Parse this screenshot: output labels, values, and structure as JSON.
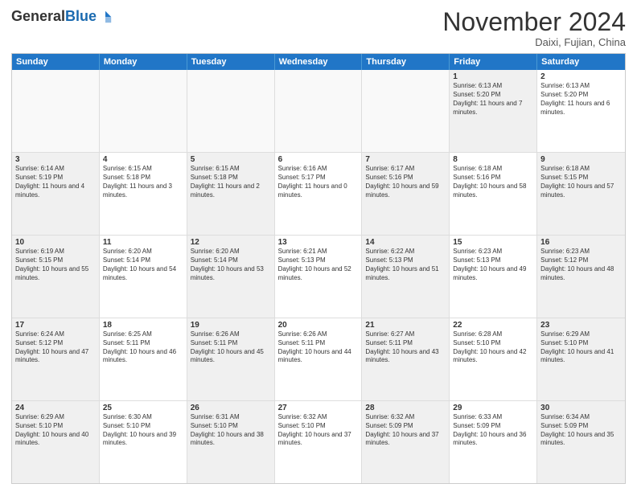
{
  "header": {
    "logo_general": "General",
    "logo_blue": "Blue",
    "month_title": "November 2024",
    "location": "Daixi, Fujian, China"
  },
  "weekdays": [
    "Sunday",
    "Monday",
    "Tuesday",
    "Wednesday",
    "Thursday",
    "Friday",
    "Saturday"
  ],
  "rows": [
    [
      {
        "day": "",
        "text": "",
        "empty": true
      },
      {
        "day": "",
        "text": "",
        "empty": true
      },
      {
        "day": "",
        "text": "",
        "empty": true
      },
      {
        "day": "",
        "text": "",
        "empty": true
      },
      {
        "day": "",
        "text": "",
        "empty": true
      },
      {
        "day": "1",
        "text": "Sunrise: 6:13 AM\nSunset: 5:20 PM\nDaylight: 11 hours and 7 minutes.",
        "shaded": true
      },
      {
        "day": "2",
        "text": "Sunrise: 6:13 AM\nSunset: 5:20 PM\nDaylight: 11 hours and 6 minutes.",
        "shaded": false
      }
    ],
    [
      {
        "day": "3",
        "text": "Sunrise: 6:14 AM\nSunset: 5:19 PM\nDaylight: 11 hours and 4 minutes.",
        "shaded": true
      },
      {
        "day": "4",
        "text": "Sunrise: 6:15 AM\nSunset: 5:18 PM\nDaylight: 11 hours and 3 minutes.",
        "shaded": false
      },
      {
        "day": "5",
        "text": "Sunrise: 6:15 AM\nSunset: 5:18 PM\nDaylight: 11 hours and 2 minutes.",
        "shaded": true
      },
      {
        "day": "6",
        "text": "Sunrise: 6:16 AM\nSunset: 5:17 PM\nDaylight: 11 hours and 0 minutes.",
        "shaded": false
      },
      {
        "day": "7",
        "text": "Sunrise: 6:17 AM\nSunset: 5:16 PM\nDaylight: 10 hours and 59 minutes.",
        "shaded": true
      },
      {
        "day": "8",
        "text": "Sunrise: 6:18 AM\nSunset: 5:16 PM\nDaylight: 10 hours and 58 minutes.",
        "shaded": false
      },
      {
        "day": "9",
        "text": "Sunrise: 6:18 AM\nSunset: 5:15 PM\nDaylight: 10 hours and 57 minutes.",
        "shaded": true
      }
    ],
    [
      {
        "day": "10",
        "text": "Sunrise: 6:19 AM\nSunset: 5:15 PM\nDaylight: 10 hours and 55 minutes.",
        "shaded": true
      },
      {
        "day": "11",
        "text": "Sunrise: 6:20 AM\nSunset: 5:14 PM\nDaylight: 10 hours and 54 minutes.",
        "shaded": false
      },
      {
        "day": "12",
        "text": "Sunrise: 6:20 AM\nSunset: 5:14 PM\nDaylight: 10 hours and 53 minutes.",
        "shaded": true
      },
      {
        "day": "13",
        "text": "Sunrise: 6:21 AM\nSunset: 5:13 PM\nDaylight: 10 hours and 52 minutes.",
        "shaded": false
      },
      {
        "day": "14",
        "text": "Sunrise: 6:22 AM\nSunset: 5:13 PM\nDaylight: 10 hours and 51 minutes.",
        "shaded": true
      },
      {
        "day": "15",
        "text": "Sunrise: 6:23 AM\nSunset: 5:13 PM\nDaylight: 10 hours and 49 minutes.",
        "shaded": false
      },
      {
        "day": "16",
        "text": "Sunrise: 6:23 AM\nSunset: 5:12 PM\nDaylight: 10 hours and 48 minutes.",
        "shaded": true
      }
    ],
    [
      {
        "day": "17",
        "text": "Sunrise: 6:24 AM\nSunset: 5:12 PM\nDaylight: 10 hours and 47 minutes.",
        "shaded": true
      },
      {
        "day": "18",
        "text": "Sunrise: 6:25 AM\nSunset: 5:11 PM\nDaylight: 10 hours and 46 minutes.",
        "shaded": false
      },
      {
        "day": "19",
        "text": "Sunrise: 6:26 AM\nSunset: 5:11 PM\nDaylight: 10 hours and 45 minutes.",
        "shaded": true
      },
      {
        "day": "20",
        "text": "Sunrise: 6:26 AM\nSunset: 5:11 PM\nDaylight: 10 hours and 44 minutes.",
        "shaded": false
      },
      {
        "day": "21",
        "text": "Sunrise: 6:27 AM\nSunset: 5:11 PM\nDaylight: 10 hours and 43 minutes.",
        "shaded": true
      },
      {
        "day": "22",
        "text": "Sunrise: 6:28 AM\nSunset: 5:10 PM\nDaylight: 10 hours and 42 minutes.",
        "shaded": false
      },
      {
        "day": "23",
        "text": "Sunrise: 6:29 AM\nSunset: 5:10 PM\nDaylight: 10 hours and 41 minutes.",
        "shaded": true
      }
    ],
    [
      {
        "day": "24",
        "text": "Sunrise: 6:29 AM\nSunset: 5:10 PM\nDaylight: 10 hours and 40 minutes.",
        "shaded": true
      },
      {
        "day": "25",
        "text": "Sunrise: 6:30 AM\nSunset: 5:10 PM\nDaylight: 10 hours and 39 minutes.",
        "shaded": false
      },
      {
        "day": "26",
        "text": "Sunrise: 6:31 AM\nSunset: 5:10 PM\nDaylight: 10 hours and 38 minutes.",
        "shaded": true
      },
      {
        "day": "27",
        "text": "Sunrise: 6:32 AM\nSunset: 5:10 PM\nDaylight: 10 hours and 37 minutes.",
        "shaded": false
      },
      {
        "day": "28",
        "text": "Sunrise: 6:32 AM\nSunset: 5:09 PM\nDaylight: 10 hours and 37 minutes.",
        "shaded": true
      },
      {
        "day": "29",
        "text": "Sunrise: 6:33 AM\nSunset: 5:09 PM\nDaylight: 10 hours and 36 minutes.",
        "shaded": false
      },
      {
        "day": "30",
        "text": "Sunrise: 6:34 AM\nSunset: 5:09 PM\nDaylight: 10 hours and 35 minutes.",
        "shaded": true
      }
    ]
  ]
}
